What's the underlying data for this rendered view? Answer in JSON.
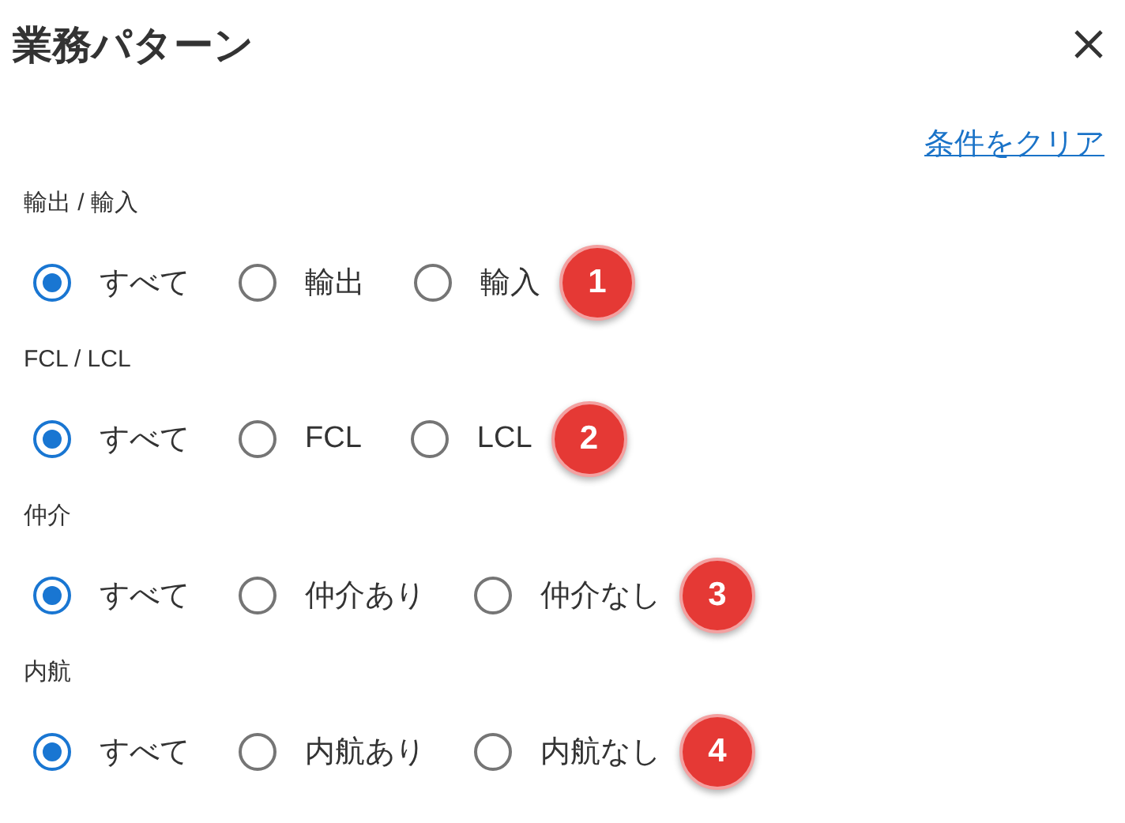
{
  "title": "業務パターン",
  "clear_link": "条件をクリア",
  "groups": [
    {
      "label": "輸出 / 輸入",
      "badge": "1",
      "options": [
        {
          "label": "すべて",
          "selected": true
        },
        {
          "label": "輸出",
          "selected": false
        },
        {
          "label": "輸入",
          "selected": false
        }
      ]
    },
    {
      "label": "FCL / LCL",
      "badge": "2",
      "options": [
        {
          "label": "すべて",
          "selected": true
        },
        {
          "label": "FCL",
          "selected": false
        },
        {
          "label": "LCL",
          "selected": false
        }
      ]
    },
    {
      "label": "仲介",
      "badge": "3",
      "options": [
        {
          "label": "すべて",
          "selected": true
        },
        {
          "label": "仲介あり",
          "selected": false
        },
        {
          "label": "仲介なし",
          "selected": false
        }
      ]
    },
    {
      "label": "内航",
      "badge": "4",
      "options": [
        {
          "label": "すべて",
          "selected": true
        },
        {
          "label": "内航あり",
          "selected": false
        },
        {
          "label": "内航なし",
          "selected": false
        }
      ]
    }
  ]
}
